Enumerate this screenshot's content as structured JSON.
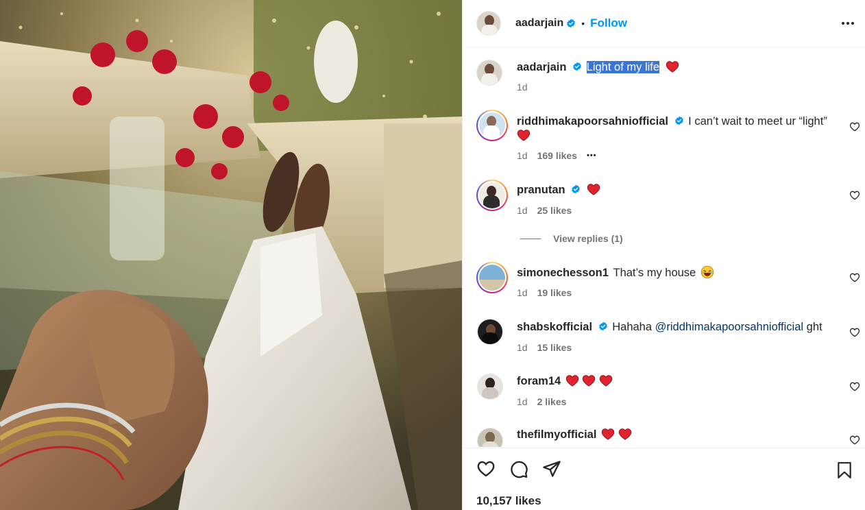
{
  "post": {
    "author": "aadarjain",
    "follow_label": "Follow",
    "dot": "•",
    "icons": {
      "verified": "verified-badge-icon",
      "more": "more-options-icon",
      "like": "heart-icon",
      "comment": "comment-icon",
      "share": "share-icon",
      "save": "bookmark-icon"
    },
    "colors": {
      "accent": "#0095f6",
      "verified": "#0095f6",
      "heart": "#e0232e",
      "selection": "#3875d7"
    }
  },
  "caption": {
    "username": "aadarjain",
    "text": "Light of my life",
    "emoji": "red-heart",
    "time": "1d"
  },
  "comments": [
    {
      "username": "riddhimakapoorsahniofficial",
      "verified": true,
      "text": "I can’t wait to meet ur “light”",
      "emoji": [
        "red-heart"
      ],
      "time": "1d",
      "likes": "169 likes",
      "more": "•••"
    },
    {
      "username": "pranutan",
      "verified": true,
      "text": "",
      "emoji": [
        "red-heart"
      ],
      "time": "1d",
      "likes": "25 likes"
    },
    {
      "username": "simonechesson1",
      "verified": false,
      "text": "That’s my house",
      "emoji": [
        "laughing-face"
      ],
      "time": "1d",
      "likes": "19 likes"
    },
    {
      "username": "shabskofficial",
      "verified": true,
      "text": "Hahaha",
      "mention": "@riddhimakapoorsahniofficial",
      "suffix": "ght",
      "time": "1d",
      "likes": "15 likes"
    },
    {
      "username": "foram14",
      "verified": false,
      "text": "",
      "emoji": [
        "red-heart",
        "red-heart",
        "red-heart"
      ],
      "time": "1d",
      "likes": "2 likes"
    },
    {
      "username": "thefilmyofficial",
      "verified": false,
      "text": "",
      "emoji": [
        "red-heart",
        "red-heart"
      ]
    }
  ],
  "view_replies": "View replies (1)",
  "likes_total": "10,157 likes"
}
